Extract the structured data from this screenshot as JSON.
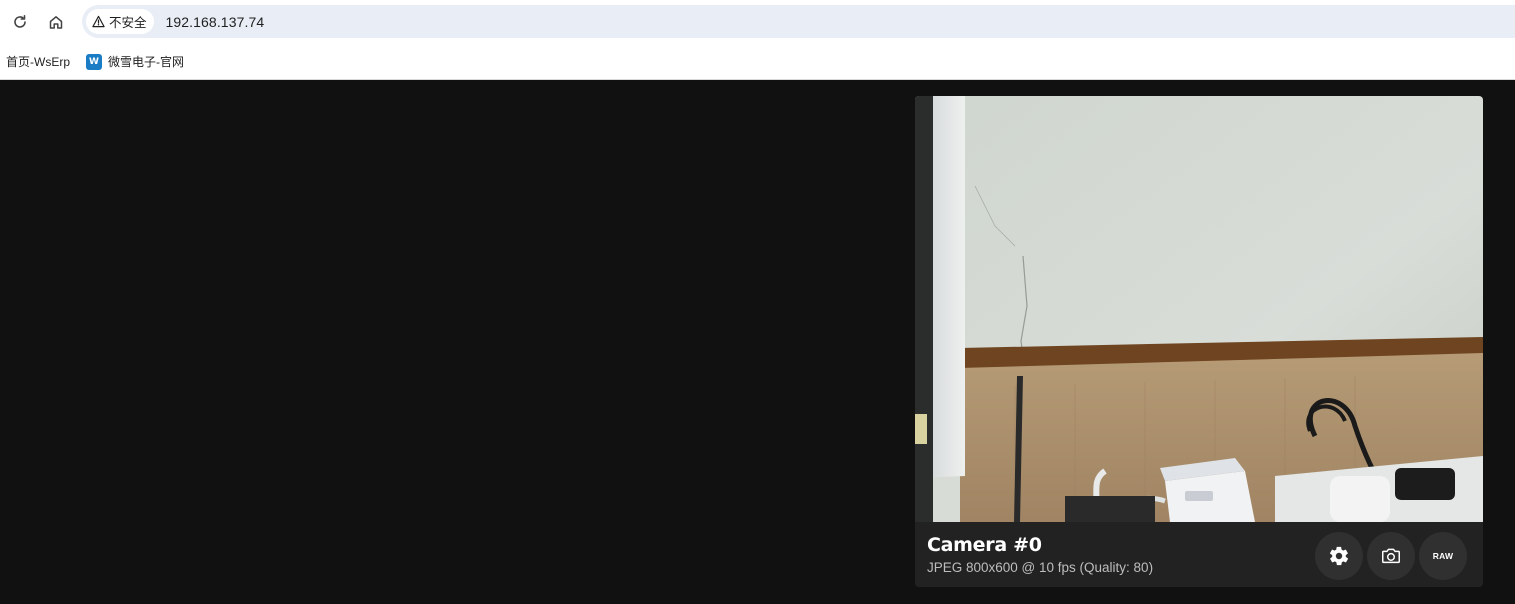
{
  "browser": {
    "security_label": "不安全",
    "url": "192.168.137.74",
    "icons": {
      "reload": "reload-icon",
      "home": "home-icon",
      "warning": "warning-triangle-icon"
    }
  },
  "bookmarks": [
    {
      "label": "首页-WsErp"
    },
    {
      "label": "微雪电子-官网",
      "favicon_text": "W"
    }
  ],
  "camera": {
    "title": "Camera #0",
    "subtitle": "JPEG 800x600 @ 10 fps (Quality: 80)",
    "buttons": {
      "settings_icon": "gear-icon",
      "snapshot_icon": "camera-icon",
      "raw_label": "RAW"
    }
  },
  "colors": {
    "page_background": "#111111",
    "card_background": "#222222",
    "button_background": "#303030",
    "omnibox_background": "#e9eef6"
  }
}
